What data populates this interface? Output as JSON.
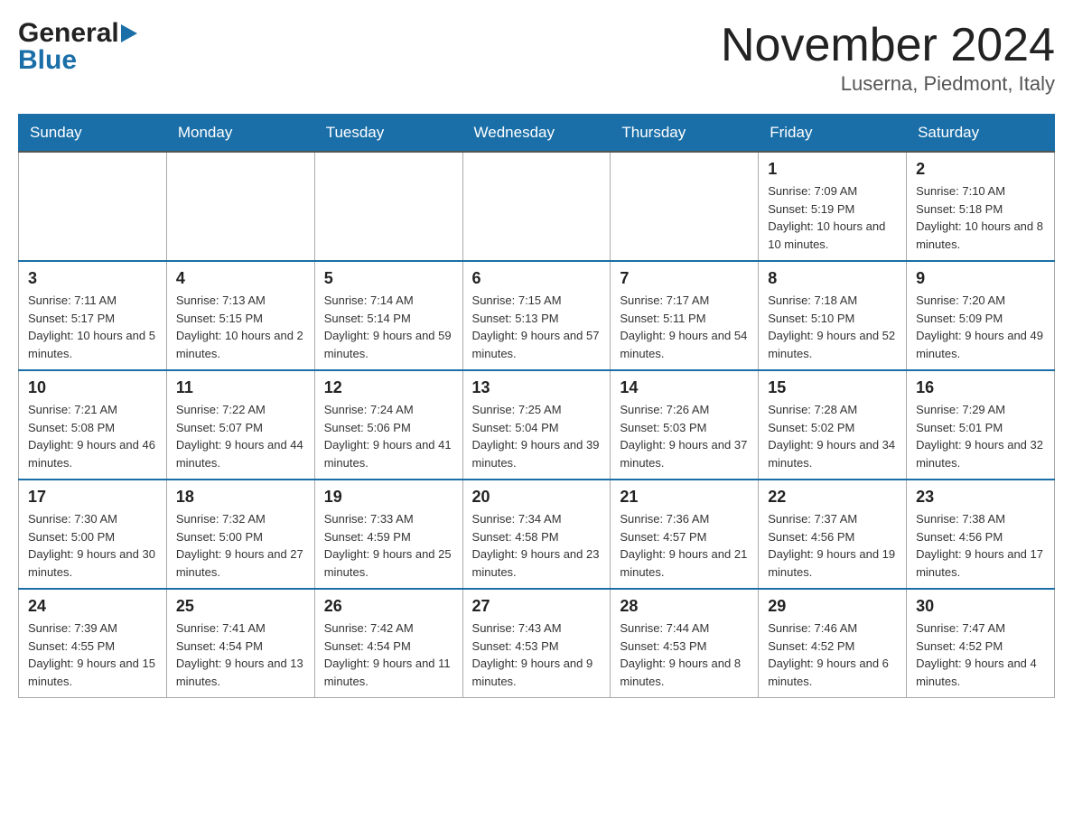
{
  "header": {
    "logo_general": "General",
    "logo_blue": "Blue",
    "title": "November 2024",
    "subtitle": "Luserna, Piedmont, Italy"
  },
  "days_of_week": [
    "Sunday",
    "Monday",
    "Tuesday",
    "Wednesday",
    "Thursday",
    "Friday",
    "Saturday"
  ],
  "weeks": [
    [
      {
        "day": "",
        "info": ""
      },
      {
        "day": "",
        "info": ""
      },
      {
        "day": "",
        "info": ""
      },
      {
        "day": "",
        "info": ""
      },
      {
        "day": "",
        "info": ""
      },
      {
        "day": "1",
        "info": "Sunrise: 7:09 AM\nSunset: 5:19 PM\nDaylight: 10 hours and 10 minutes."
      },
      {
        "day": "2",
        "info": "Sunrise: 7:10 AM\nSunset: 5:18 PM\nDaylight: 10 hours and 8 minutes."
      }
    ],
    [
      {
        "day": "3",
        "info": "Sunrise: 7:11 AM\nSunset: 5:17 PM\nDaylight: 10 hours and 5 minutes."
      },
      {
        "day": "4",
        "info": "Sunrise: 7:13 AM\nSunset: 5:15 PM\nDaylight: 10 hours and 2 minutes."
      },
      {
        "day": "5",
        "info": "Sunrise: 7:14 AM\nSunset: 5:14 PM\nDaylight: 9 hours and 59 minutes."
      },
      {
        "day": "6",
        "info": "Sunrise: 7:15 AM\nSunset: 5:13 PM\nDaylight: 9 hours and 57 minutes."
      },
      {
        "day": "7",
        "info": "Sunrise: 7:17 AM\nSunset: 5:11 PM\nDaylight: 9 hours and 54 minutes."
      },
      {
        "day": "8",
        "info": "Sunrise: 7:18 AM\nSunset: 5:10 PM\nDaylight: 9 hours and 52 minutes."
      },
      {
        "day": "9",
        "info": "Sunrise: 7:20 AM\nSunset: 5:09 PM\nDaylight: 9 hours and 49 minutes."
      }
    ],
    [
      {
        "day": "10",
        "info": "Sunrise: 7:21 AM\nSunset: 5:08 PM\nDaylight: 9 hours and 46 minutes."
      },
      {
        "day": "11",
        "info": "Sunrise: 7:22 AM\nSunset: 5:07 PM\nDaylight: 9 hours and 44 minutes."
      },
      {
        "day": "12",
        "info": "Sunrise: 7:24 AM\nSunset: 5:06 PM\nDaylight: 9 hours and 41 minutes."
      },
      {
        "day": "13",
        "info": "Sunrise: 7:25 AM\nSunset: 5:04 PM\nDaylight: 9 hours and 39 minutes."
      },
      {
        "day": "14",
        "info": "Sunrise: 7:26 AM\nSunset: 5:03 PM\nDaylight: 9 hours and 37 minutes."
      },
      {
        "day": "15",
        "info": "Sunrise: 7:28 AM\nSunset: 5:02 PM\nDaylight: 9 hours and 34 minutes."
      },
      {
        "day": "16",
        "info": "Sunrise: 7:29 AM\nSunset: 5:01 PM\nDaylight: 9 hours and 32 minutes."
      }
    ],
    [
      {
        "day": "17",
        "info": "Sunrise: 7:30 AM\nSunset: 5:00 PM\nDaylight: 9 hours and 30 minutes."
      },
      {
        "day": "18",
        "info": "Sunrise: 7:32 AM\nSunset: 5:00 PM\nDaylight: 9 hours and 27 minutes."
      },
      {
        "day": "19",
        "info": "Sunrise: 7:33 AM\nSunset: 4:59 PM\nDaylight: 9 hours and 25 minutes."
      },
      {
        "day": "20",
        "info": "Sunrise: 7:34 AM\nSunset: 4:58 PM\nDaylight: 9 hours and 23 minutes."
      },
      {
        "day": "21",
        "info": "Sunrise: 7:36 AM\nSunset: 4:57 PM\nDaylight: 9 hours and 21 minutes."
      },
      {
        "day": "22",
        "info": "Sunrise: 7:37 AM\nSunset: 4:56 PM\nDaylight: 9 hours and 19 minutes."
      },
      {
        "day": "23",
        "info": "Sunrise: 7:38 AM\nSunset: 4:56 PM\nDaylight: 9 hours and 17 minutes."
      }
    ],
    [
      {
        "day": "24",
        "info": "Sunrise: 7:39 AM\nSunset: 4:55 PM\nDaylight: 9 hours and 15 minutes."
      },
      {
        "day": "25",
        "info": "Sunrise: 7:41 AM\nSunset: 4:54 PM\nDaylight: 9 hours and 13 minutes."
      },
      {
        "day": "26",
        "info": "Sunrise: 7:42 AM\nSunset: 4:54 PM\nDaylight: 9 hours and 11 minutes."
      },
      {
        "day": "27",
        "info": "Sunrise: 7:43 AM\nSunset: 4:53 PM\nDaylight: 9 hours and 9 minutes."
      },
      {
        "day": "28",
        "info": "Sunrise: 7:44 AM\nSunset: 4:53 PM\nDaylight: 9 hours and 8 minutes."
      },
      {
        "day": "29",
        "info": "Sunrise: 7:46 AM\nSunset: 4:52 PM\nDaylight: 9 hours and 6 minutes."
      },
      {
        "day": "30",
        "info": "Sunrise: 7:47 AM\nSunset: 4:52 PM\nDaylight: 9 hours and 4 minutes."
      }
    ]
  ]
}
